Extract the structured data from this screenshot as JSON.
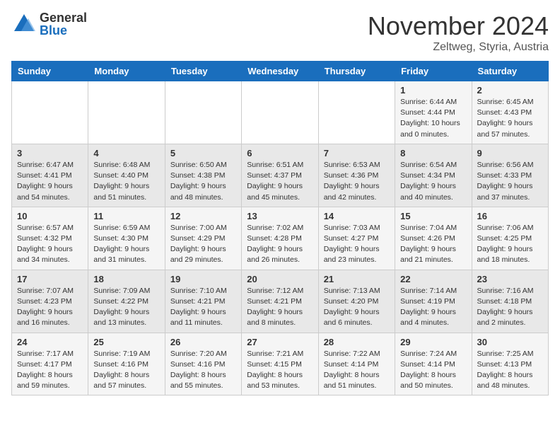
{
  "logo": {
    "general": "General",
    "blue": "Blue"
  },
  "header": {
    "month": "November 2024",
    "location": "Zeltweg, Styria, Austria"
  },
  "weekdays": [
    "Sunday",
    "Monday",
    "Tuesday",
    "Wednesday",
    "Thursday",
    "Friday",
    "Saturday"
  ],
  "weeks": [
    [
      {
        "day": "",
        "info": ""
      },
      {
        "day": "",
        "info": ""
      },
      {
        "day": "",
        "info": ""
      },
      {
        "day": "",
        "info": ""
      },
      {
        "day": "",
        "info": ""
      },
      {
        "day": "1",
        "info": "Sunrise: 6:44 AM\nSunset: 4:44 PM\nDaylight: 10 hours\nand 0 minutes."
      },
      {
        "day": "2",
        "info": "Sunrise: 6:45 AM\nSunset: 4:43 PM\nDaylight: 9 hours\nand 57 minutes."
      }
    ],
    [
      {
        "day": "3",
        "info": "Sunrise: 6:47 AM\nSunset: 4:41 PM\nDaylight: 9 hours\nand 54 minutes."
      },
      {
        "day": "4",
        "info": "Sunrise: 6:48 AM\nSunset: 4:40 PM\nDaylight: 9 hours\nand 51 minutes."
      },
      {
        "day": "5",
        "info": "Sunrise: 6:50 AM\nSunset: 4:38 PM\nDaylight: 9 hours\nand 48 minutes."
      },
      {
        "day": "6",
        "info": "Sunrise: 6:51 AM\nSunset: 4:37 PM\nDaylight: 9 hours\nand 45 minutes."
      },
      {
        "day": "7",
        "info": "Sunrise: 6:53 AM\nSunset: 4:36 PM\nDaylight: 9 hours\nand 42 minutes."
      },
      {
        "day": "8",
        "info": "Sunrise: 6:54 AM\nSunset: 4:34 PM\nDaylight: 9 hours\nand 40 minutes."
      },
      {
        "day": "9",
        "info": "Sunrise: 6:56 AM\nSunset: 4:33 PM\nDaylight: 9 hours\nand 37 minutes."
      }
    ],
    [
      {
        "day": "10",
        "info": "Sunrise: 6:57 AM\nSunset: 4:32 PM\nDaylight: 9 hours\nand 34 minutes."
      },
      {
        "day": "11",
        "info": "Sunrise: 6:59 AM\nSunset: 4:30 PM\nDaylight: 9 hours\nand 31 minutes."
      },
      {
        "day": "12",
        "info": "Sunrise: 7:00 AM\nSunset: 4:29 PM\nDaylight: 9 hours\nand 29 minutes."
      },
      {
        "day": "13",
        "info": "Sunrise: 7:02 AM\nSunset: 4:28 PM\nDaylight: 9 hours\nand 26 minutes."
      },
      {
        "day": "14",
        "info": "Sunrise: 7:03 AM\nSunset: 4:27 PM\nDaylight: 9 hours\nand 23 minutes."
      },
      {
        "day": "15",
        "info": "Sunrise: 7:04 AM\nSunset: 4:26 PM\nDaylight: 9 hours\nand 21 minutes."
      },
      {
        "day": "16",
        "info": "Sunrise: 7:06 AM\nSunset: 4:25 PM\nDaylight: 9 hours\nand 18 minutes."
      }
    ],
    [
      {
        "day": "17",
        "info": "Sunrise: 7:07 AM\nSunset: 4:23 PM\nDaylight: 9 hours\nand 16 minutes."
      },
      {
        "day": "18",
        "info": "Sunrise: 7:09 AM\nSunset: 4:22 PM\nDaylight: 9 hours\nand 13 minutes."
      },
      {
        "day": "19",
        "info": "Sunrise: 7:10 AM\nSunset: 4:21 PM\nDaylight: 9 hours\nand 11 minutes."
      },
      {
        "day": "20",
        "info": "Sunrise: 7:12 AM\nSunset: 4:21 PM\nDaylight: 9 hours\nand 8 minutes."
      },
      {
        "day": "21",
        "info": "Sunrise: 7:13 AM\nSunset: 4:20 PM\nDaylight: 9 hours\nand 6 minutes."
      },
      {
        "day": "22",
        "info": "Sunrise: 7:14 AM\nSunset: 4:19 PM\nDaylight: 9 hours\nand 4 minutes."
      },
      {
        "day": "23",
        "info": "Sunrise: 7:16 AM\nSunset: 4:18 PM\nDaylight: 9 hours\nand 2 minutes."
      }
    ],
    [
      {
        "day": "24",
        "info": "Sunrise: 7:17 AM\nSunset: 4:17 PM\nDaylight: 8 hours\nand 59 minutes."
      },
      {
        "day": "25",
        "info": "Sunrise: 7:19 AM\nSunset: 4:16 PM\nDaylight: 8 hours\nand 57 minutes."
      },
      {
        "day": "26",
        "info": "Sunrise: 7:20 AM\nSunset: 4:16 PM\nDaylight: 8 hours\nand 55 minutes."
      },
      {
        "day": "27",
        "info": "Sunrise: 7:21 AM\nSunset: 4:15 PM\nDaylight: 8 hours\nand 53 minutes."
      },
      {
        "day": "28",
        "info": "Sunrise: 7:22 AM\nSunset: 4:14 PM\nDaylight: 8 hours\nand 51 minutes."
      },
      {
        "day": "29",
        "info": "Sunrise: 7:24 AM\nSunset: 4:14 PM\nDaylight: 8 hours\nand 50 minutes."
      },
      {
        "day": "30",
        "info": "Sunrise: 7:25 AM\nSunset: 4:13 PM\nDaylight: 8 hours\nand 48 minutes."
      }
    ]
  ]
}
